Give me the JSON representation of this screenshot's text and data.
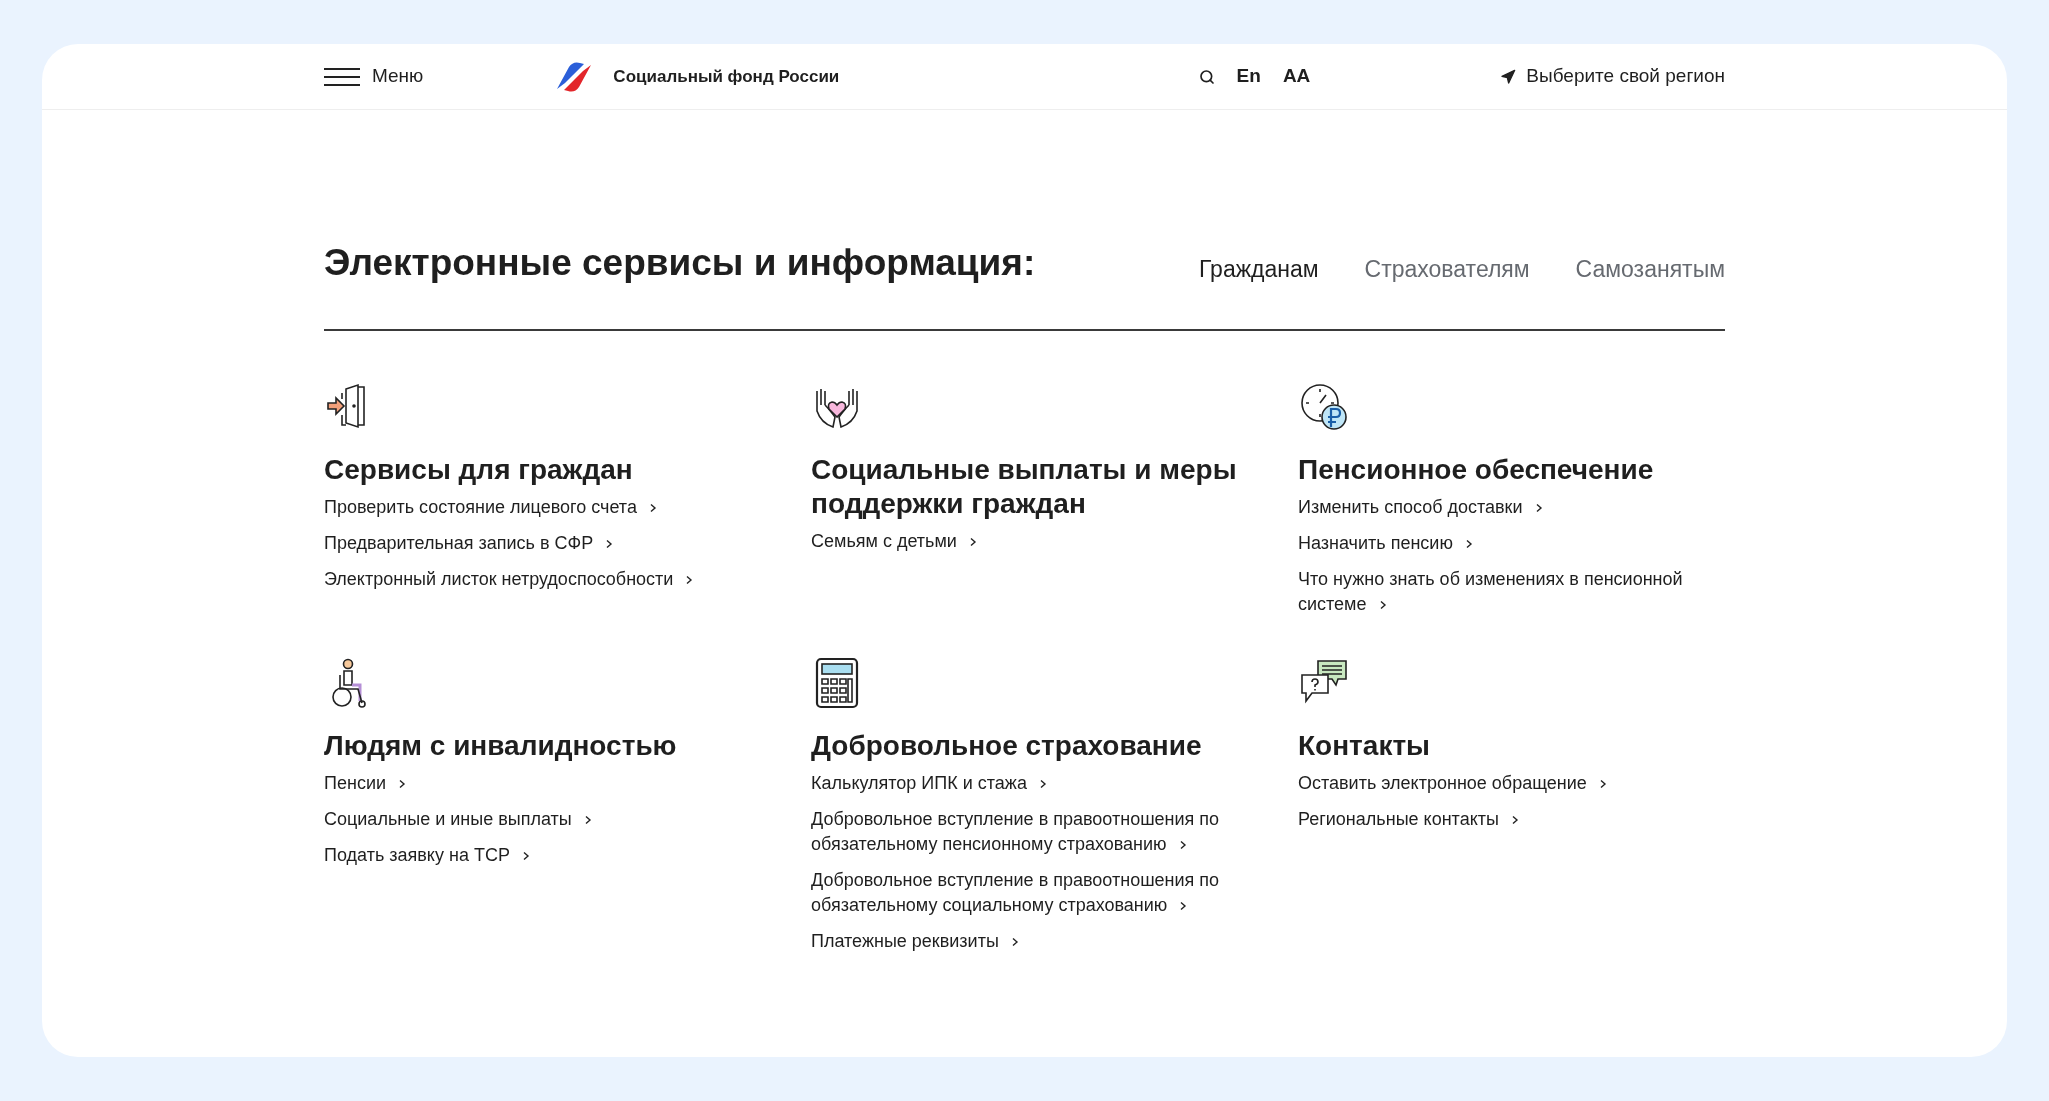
{
  "header": {
    "menu_label": "Меню",
    "logo_text": "Социальный фонд России",
    "language": "En",
    "font_size": "AA",
    "region": "Выберите свой регион"
  },
  "heading": "Электронные сервисы и информация:",
  "tabs": [
    {
      "label": "Гражданам",
      "selected": true
    },
    {
      "label": "Страхователям",
      "selected": false
    },
    {
      "label": "Самозанятым",
      "selected": false
    }
  ],
  "sections": [
    {
      "kind": "door",
      "title": "Сервисы для граждан",
      "links": [
        "Проверить состояние лицевого счета",
        "Предварительная запись в СФР",
        "Электронный листок нетрудоспособности"
      ]
    },
    {
      "kind": "hands",
      "title": "Социальные выплаты и меры поддержки граждан",
      "links": [
        "Семьям с детьми"
      ]
    },
    {
      "kind": "clock",
      "title": "Пенсионное обеспечение",
      "links": [
        "Изменить способ доставки",
        "Назначить пенсию",
        "Что нужно знать об изменениях в пенсионной системе"
      ]
    },
    {
      "kind": "wheelchair",
      "title": "Людям с инвалидностью",
      "links": [
        "Пенсии",
        "Социальные и иные выплаты",
        "Подать заявку на ТСР"
      ]
    },
    {
      "kind": "calculator",
      "title": "Добровольное страхование",
      "links": [
        "Калькулятор ИПК и стажа",
        "Добровольное вступление в правоотношения по обязательному пенсионному страхованию",
        "Добровольное вступление в правоотношения по обязательному социальному страхованию",
        "Платежные реквизиты"
      ]
    },
    {
      "kind": "chat",
      "title": "Контакты",
      "links": [
        "Оставить электронное обращение",
        "Региональные контакты"
      ]
    }
  ]
}
